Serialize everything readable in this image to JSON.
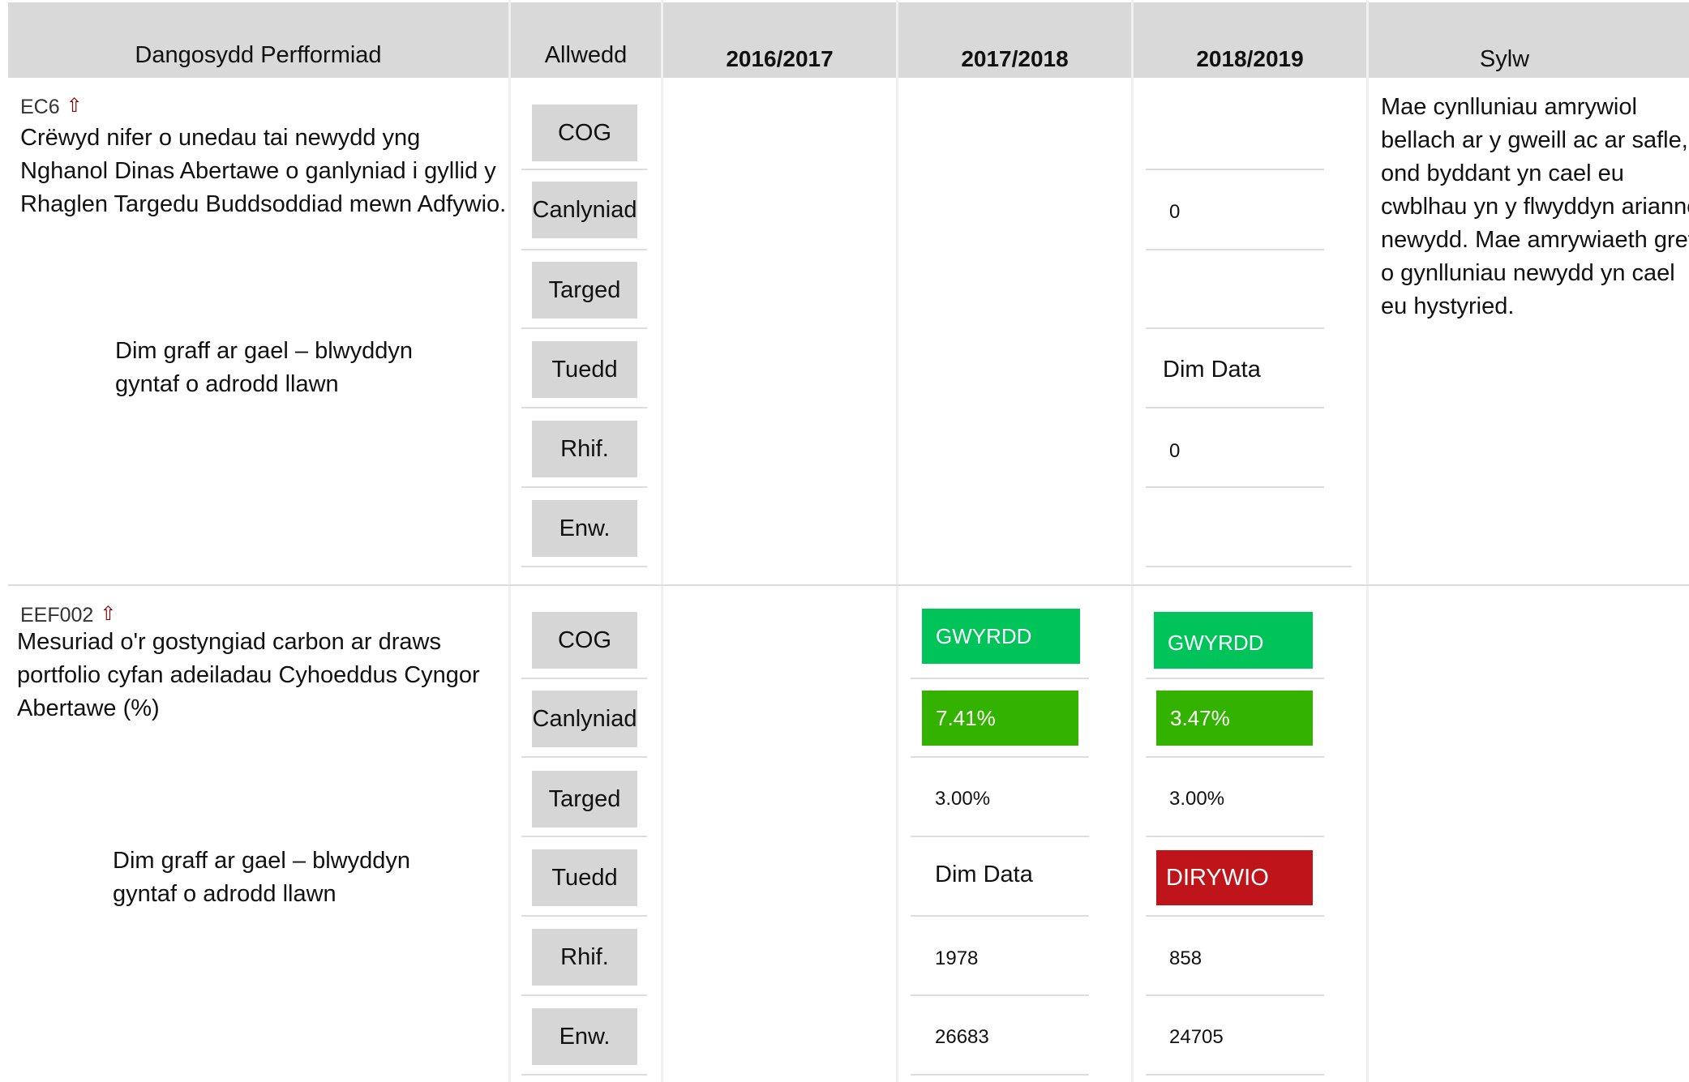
{
  "header": {
    "indicator": "Dangosydd Perfformiad",
    "key": "Allwedd",
    "years": [
      "2016/2017",
      "2017/2018",
      "2018/2019"
    ],
    "comment": "Sylw"
  },
  "colors": {
    "green_bright": "#00c45a",
    "green": "#33b200",
    "red": "#c0141b",
    "arrow": "#8b0000",
    "header_bg": "#d9d9d9",
    "key_bg": "#d6d6d6"
  },
  "rows": [
    {
      "code": "EC6",
      "arrow_icon": "up-arrow-icon",
      "description": "Crëwyd nifer o unedau tai newydd yng Nghanol Dinas Abertawe o ganlyniad i gyllid y Rhaglen Targedu Buddsoddiad mewn Adfywio.",
      "no_graph": "Dim graff ar gael – blwyddyn gyntaf o adrodd llawn",
      "keys": [
        "COG",
        "Canlyniad",
        "Targed",
        "Tuedd",
        "Rhif.",
        "Enw."
      ],
      "values_2017_2018": {
        "cog": "",
        "canlyniad": "",
        "targed": "",
        "tuedd": "",
        "rhif": "",
        "enw": ""
      },
      "values_2018_2019": {
        "cog": "",
        "canlyniad": "0",
        "targed": "",
        "tuedd": "Dim Data",
        "rhif": "0",
        "enw": ""
      },
      "comment": "Mae cynlluniau amrywiol bellach ar y gweill ac ar safle, ond byddant yn cael eu cwblhau yn y flwyddyn ariannol newydd. Mae amrywiaeth gref o gynlluniau newydd yn cael eu hystyried."
    },
    {
      "code": "EEF002",
      "arrow_icon": "up-arrow-icon",
      "description": "Mesuriad o'r gostyngiad carbon ar draws portfolio cyfan adeiladau Cyhoeddus Cyngor Abertawe (%)",
      "no_graph": "Dim graff ar gael – blwyddyn gyntaf o adrodd llawn",
      "keys": [
        "COG",
        "Canlyniad",
        "Targed",
        "Tuedd",
        "Rhif.",
        "Enw."
      ],
      "values_2017_2018": {
        "cog": "GWYRDD",
        "canlyniad": "7.41%",
        "targed": "3.00%",
        "tuedd": "Dim Data",
        "rhif": "1978",
        "enw": "26683"
      },
      "values_2018_2019": {
        "cog": "GWYRDD",
        "canlyniad": "3.47%",
        "targed": "3.00%",
        "tuedd": "DIRYWIO",
        "rhif": "858",
        "enw": "24705"
      },
      "comment": ""
    }
  ]
}
